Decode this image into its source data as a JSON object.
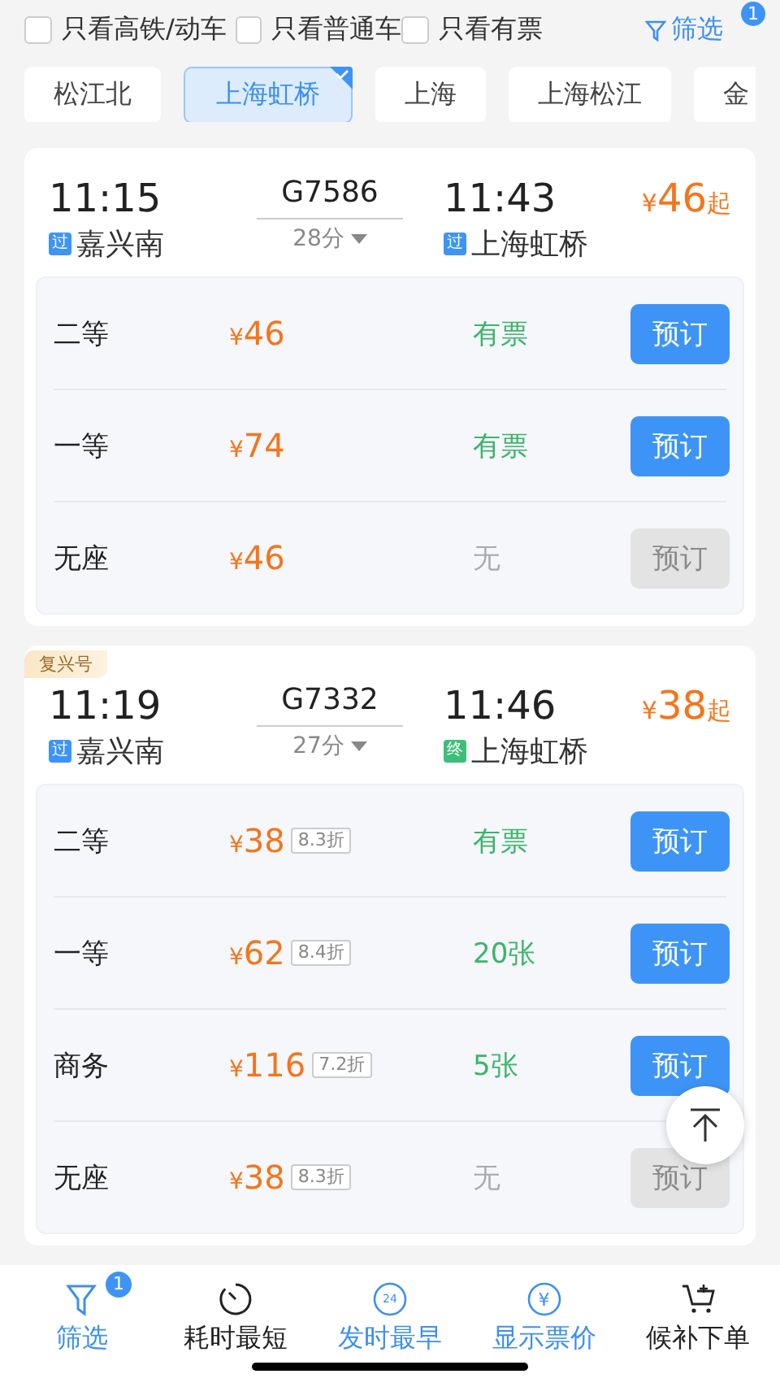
{
  "filters": [
    {
      "label": "只看高铁/动车",
      "checked": false
    },
    {
      "label": "只看普通车",
      "checked": false
    },
    {
      "label": "只看有票",
      "checked": false
    }
  ],
  "filter_button": {
    "label": "筛选",
    "badge": "1"
  },
  "stations": [
    {
      "label": "松江北",
      "selected": false
    },
    {
      "label": "上海虹桥",
      "selected": true
    },
    {
      "label": "上海",
      "selected": false
    },
    {
      "label": "上海松江",
      "selected": false
    },
    {
      "label": "金",
      "selected": false
    }
  ],
  "trains": [
    {
      "depart_time": "11:15",
      "train_no": "G7586",
      "arrive_time": "11:43",
      "from": {
        "mark": "过",
        "kind": "pass",
        "name": "嘉兴南"
      },
      "to": {
        "mark": "过",
        "kind": "pass",
        "name": "上海虹桥"
      },
      "duration": "28分",
      "currency": "¥",
      "price": "46",
      "price_suffix": "起",
      "seats": [
        {
          "name": "二等",
          "currency": "¥",
          "price": "46",
          "availability": "有票",
          "available": true,
          "button": "预订"
        },
        {
          "name": "一等",
          "currency": "¥",
          "price": "74",
          "availability": "有票",
          "available": true,
          "button": "预订"
        },
        {
          "name": "无座",
          "currency": "¥",
          "price": "46",
          "availability": "无",
          "available": false,
          "button": "预订"
        }
      ]
    },
    {
      "tag": "复兴号",
      "depart_time": "11:19",
      "train_no": "G7332",
      "arrive_time": "11:46",
      "from": {
        "mark": "过",
        "kind": "pass",
        "name": "嘉兴南"
      },
      "to": {
        "mark": "终",
        "kind": "terminal",
        "name": "上海虹桥"
      },
      "duration": "27分",
      "currency": "¥",
      "price": "38",
      "price_suffix": "起",
      "seats": [
        {
          "name": "二等",
          "currency": "¥",
          "price": "38",
          "discount": "8.3折",
          "availability": "有票",
          "available": true,
          "button": "预订"
        },
        {
          "name": "一等",
          "currency": "¥",
          "price": "62",
          "discount": "8.4折",
          "availability": "20张",
          "available": true,
          "button": "预订"
        },
        {
          "name": "商务",
          "currency": "¥",
          "price": "116",
          "discount": "7.2折",
          "availability": "5张",
          "available": true,
          "button": "预订"
        },
        {
          "name": "无座",
          "currency": "¥",
          "price": "38",
          "discount": "8.3折",
          "availability": "无",
          "available": false,
          "button": "预订"
        }
      ]
    }
  ],
  "bottom_nav": [
    {
      "kind": "filter",
      "label": "筛选",
      "badge": "1",
      "selected": true
    },
    {
      "kind": "timer",
      "label": "耗时最短",
      "selected": false
    },
    {
      "kind": "clock24",
      "label": "发时最早",
      "icon_text": "24",
      "selected": true
    },
    {
      "kind": "yen",
      "label": "显示票价",
      "icon_text": "¥",
      "selected": true
    },
    {
      "kind": "cart",
      "label": "候补下单",
      "selected": false
    }
  ]
}
